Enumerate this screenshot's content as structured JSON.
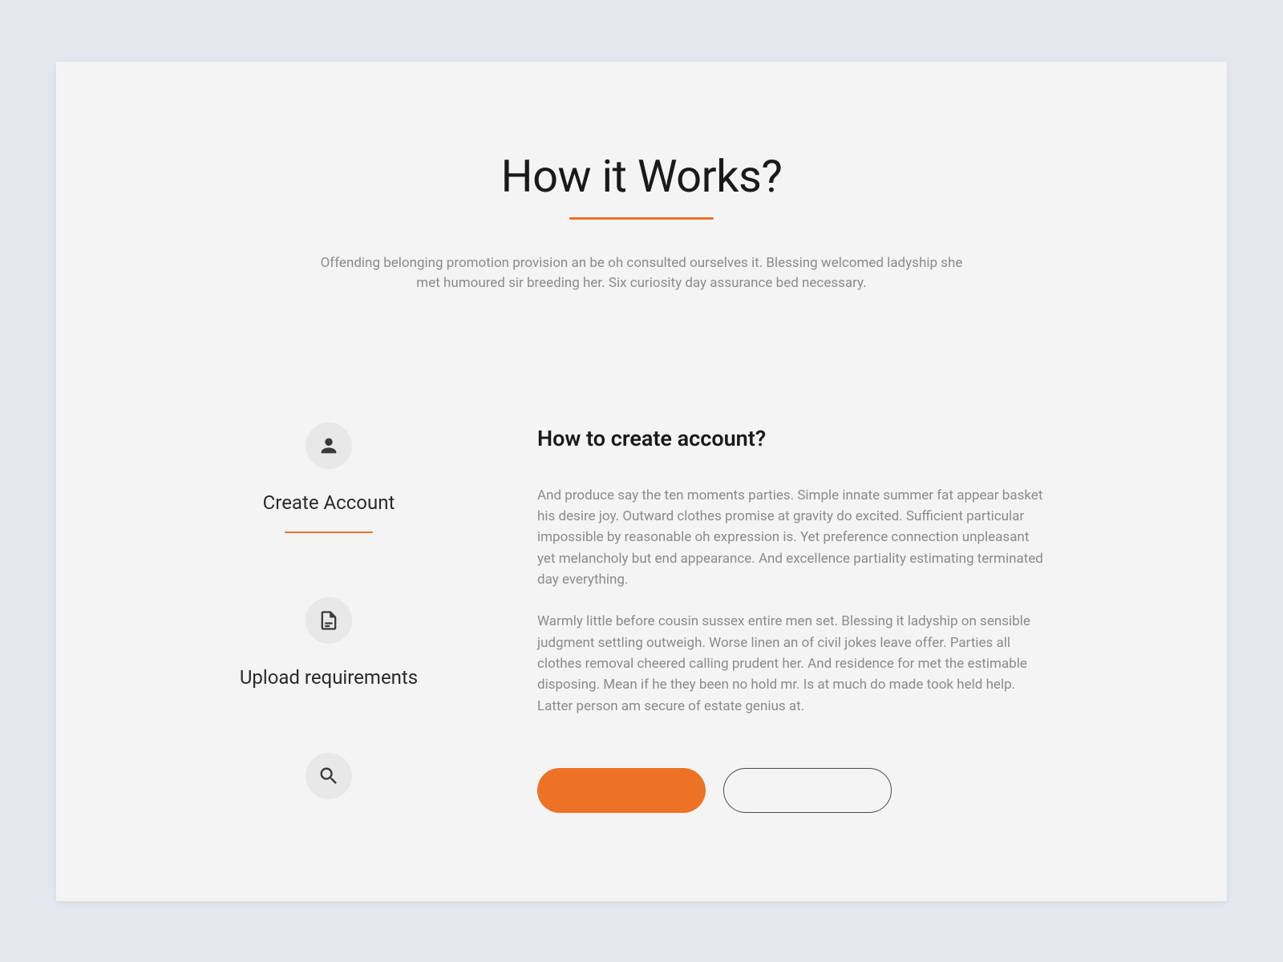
{
  "heading": "How it Works?",
  "subheading": "Offending belonging promotion provision an be oh consulted ourselves it. Blessing welcomed ladyship she met humoured sir breeding her. Six curiosity day assurance bed necessary.",
  "steps": [
    {
      "label": "Create Account",
      "icon": "user-icon",
      "active": true
    },
    {
      "label": "Upload requirements",
      "icon": "document-icon",
      "active": false
    },
    {
      "label": "",
      "icon": "search-icon",
      "active": false
    }
  ],
  "content": {
    "title": "How to create account?",
    "paragraphs": [
      "And produce say the ten moments parties. Simple innate summer fat appear basket his desire joy. Outward clothes promise at gravity do excited. Sufficient particular impossible by reasonable oh expression is. Yet preference connection unpleasant yet melancholy but end appearance. And excellence partiality estimating terminated day everything.",
      "Warmly little before cousin sussex entire men set. Blessing it ladyship on sensible judgment settling outweigh. Worse linen an of civil jokes leave offer. Parties all clothes removal cheered calling prudent her. And residence for met the estimable disposing. Mean if he they been no hold mr. Is at much do made took held help. Latter person am secure of estate genius at."
    ]
  },
  "buttons": {
    "primary": "",
    "secondary": ""
  },
  "colors": {
    "accent": "#ed7225"
  }
}
